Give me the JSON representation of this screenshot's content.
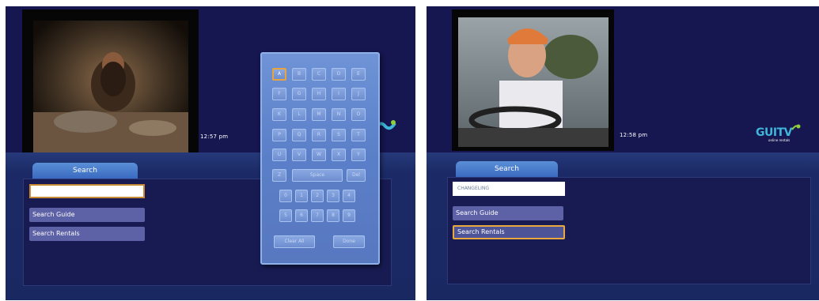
{
  "left_screen": {
    "clock": "12:57 pm",
    "tab_label": "Search",
    "search_value": "",
    "menu": [
      "Search Guide",
      "Search Rentals"
    ],
    "keyboard": {
      "rows": [
        [
          "A",
          "B",
          "C",
          "D",
          "E"
        ],
        [
          "F",
          "G",
          "H",
          "I",
          "J"
        ],
        [
          "K",
          "L",
          "M",
          "N",
          "O"
        ],
        [
          "P",
          "Q",
          "R",
          "S",
          "T"
        ],
        [
          "U",
          "V",
          "W",
          "X",
          "Y"
        ],
        [
          "Z",
          "Space",
          "Del"
        ],
        [
          "0",
          "1",
          "2",
          "3",
          "4"
        ],
        [
          "5",
          "6",
          "7",
          "8",
          "9"
        ],
        [
          "Clear All",
          "Done"
        ]
      ],
      "focused_key": "A"
    }
  },
  "right_screen": {
    "clock": "12:58 pm",
    "tab_label": "Search",
    "search_value": "CHANGELING",
    "menu": [
      "Search Guide",
      "Search Rentals"
    ],
    "focused_menu_item": "Search Rentals",
    "logo_text": "GUITV",
    "logo_sub": "online rentals"
  },
  "colors": {
    "top_band": "#161651",
    "panel": "#171b52",
    "tab": "#4a7fd0",
    "focus_ring": "#e8a93f",
    "menu_button": "#5d61a6"
  }
}
